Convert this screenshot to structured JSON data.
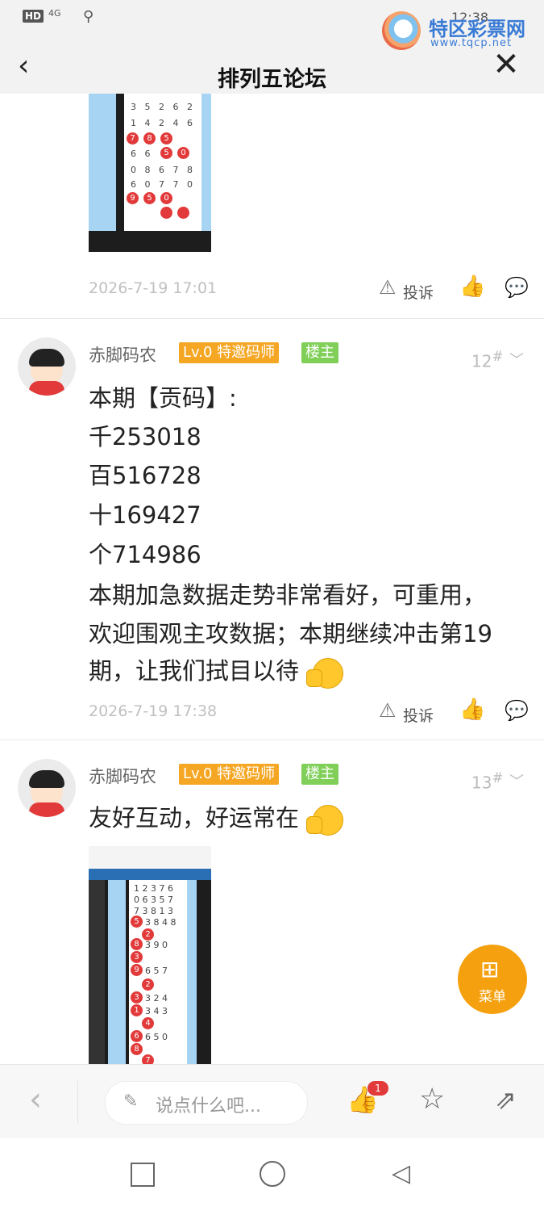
{
  "statusbar": {
    "hd": "HD",
    "net": "4G",
    "time": "12:38"
  },
  "watermark": {
    "text": "特区彩票网",
    "url": "www.tqcp.net"
  },
  "header": {
    "title": "排列五论坛"
  },
  "post11": {
    "date": "2026-7-19 17:01",
    "report": "投诉"
  },
  "post12": {
    "user": "赤脚码农",
    "level": "Lv.0 特邀码师",
    "role": "楼主",
    "floor": "12",
    "lines": [
      "本期【贡码】:",
      "千253018",
      "百516728",
      "十169427",
      "个714986",
      "本期加急数据走势非常看好，可重用，",
      "欢迎围观主攻数据；本期继续冲击第19",
      "期，让我们拭目以待"
    ],
    "date": "2026-7-19 17:38",
    "report": "投诉"
  },
  "post13": {
    "user": "赤脚码农",
    "level": "Lv.0 特邀码师",
    "role": "楼主",
    "floor": "13",
    "line": "友好互动，好运常在"
  },
  "fab": {
    "label": "菜单"
  },
  "bottombar": {
    "placeholder": "说点什么吧...",
    "like_count": "1"
  },
  "colors": {
    "accent": "#f5a00e",
    "badge_orange": "#f5a623",
    "badge_green": "#7fcf58",
    "ball_red": "#e23a3a"
  }
}
